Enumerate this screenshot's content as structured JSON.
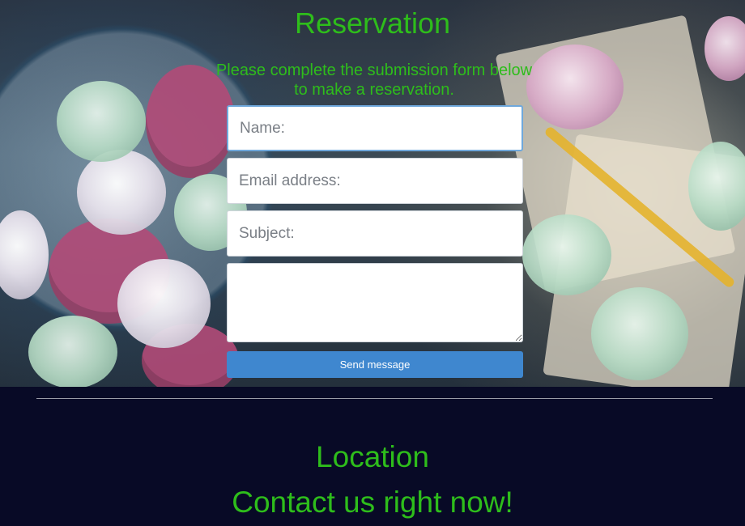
{
  "reservation": {
    "title": "Reservation",
    "subtitle": "Please complete the submission form below to make a reservation."
  },
  "form": {
    "name_placeholder": "Name:",
    "email_placeholder": "Email address:",
    "subject_placeholder": "Subject:",
    "message_placeholder": "",
    "send_label": "Send message"
  },
  "footer": {
    "location_heading": "Location",
    "contact_heading": "Contact us right now!"
  },
  "colors": {
    "heading_green": "#2ebd1b",
    "button_blue": "#3f87cf",
    "footer_navy": "#080a26"
  }
}
